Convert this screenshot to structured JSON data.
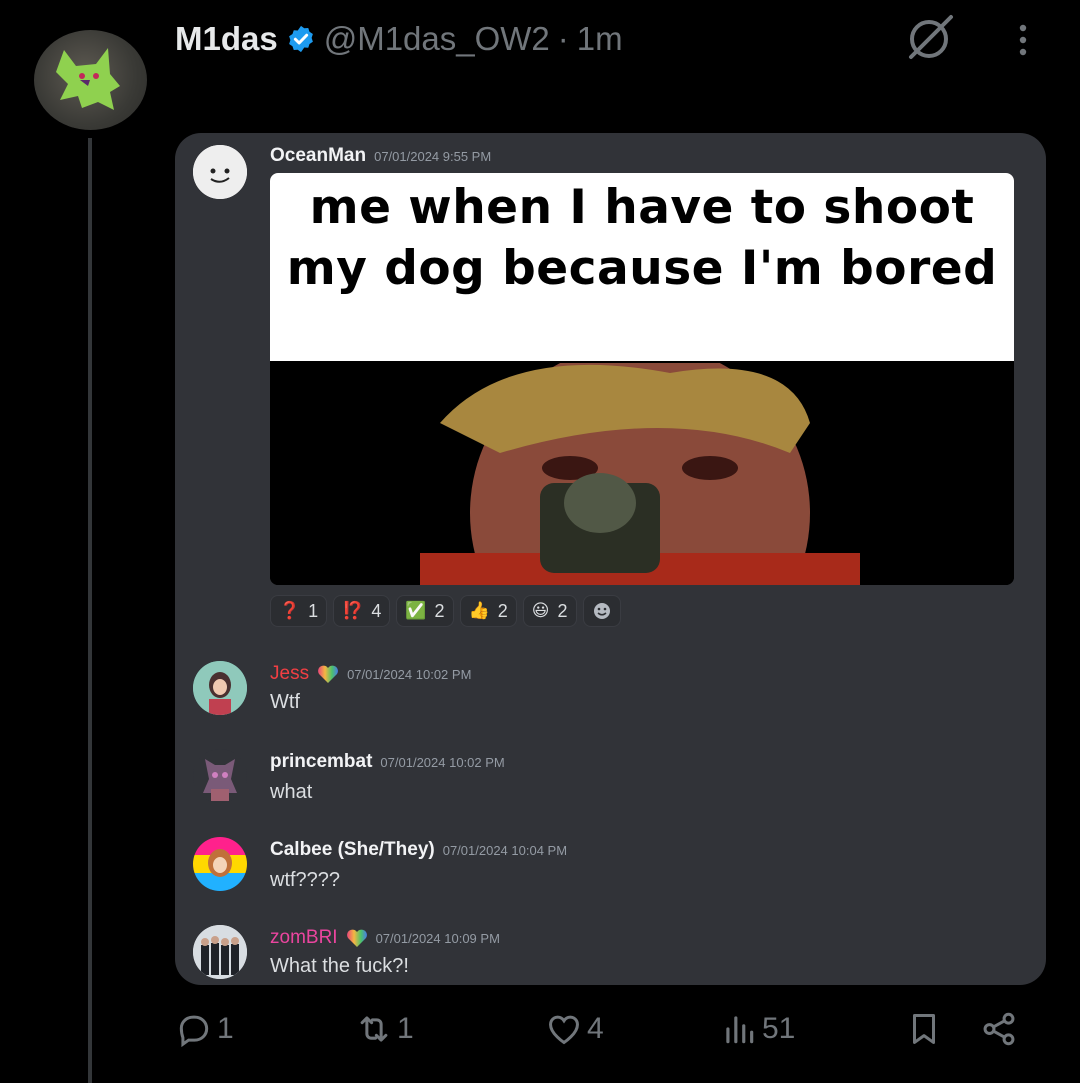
{
  "tweet": {
    "display_name": "M1das",
    "handle": "@M1das_OW2",
    "dot": "·",
    "time": "1m"
  },
  "embed": {
    "first_message": {
      "author": "OceanMan",
      "timestamp": "07/01/2024 9:55 PM",
      "meme_caption": "me when I have to shoot my dog because I'm bored"
    },
    "reactions": [
      {
        "emoji": "❓",
        "count": "1"
      },
      {
        "emoji": "⁉️",
        "count": "4"
      },
      {
        "emoji": "✅",
        "count": "2"
      },
      {
        "emoji": "👍",
        "count": "2"
      },
      {
        "emoji": "😃",
        "count": "2"
      }
    ],
    "messages": [
      {
        "author": "Jess",
        "timestamp": "07/01/2024 10:02 PM",
        "text": "Wtf",
        "color": "#f23f43"
      },
      {
        "author": "princembat",
        "timestamp": "07/01/2024 10:02 PM",
        "text": "what",
        "color": "#f2f3f5"
      },
      {
        "author": "Calbee (She/They)",
        "timestamp": "07/01/2024 10:04 PM",
        "text": "wtf????",
        "color": "#f2f3f5"
      },
      {
        "author": "zomBRI",
        "timestamp": "07/01/2024 10:09 PM",
        "text": "What the fuck?!",
        "color": "#eb459f"
      }
    ]
  },
  "actions": {
    "replies": "1",
    "reposts": "1",
    "likes": "4",
    "views": "51"
  },
  "colors": {
    "background": "#000000",
    "card": "#313338",
    "verified": "#1d9bf0",
    "muted": "#71767b"
  }
}
